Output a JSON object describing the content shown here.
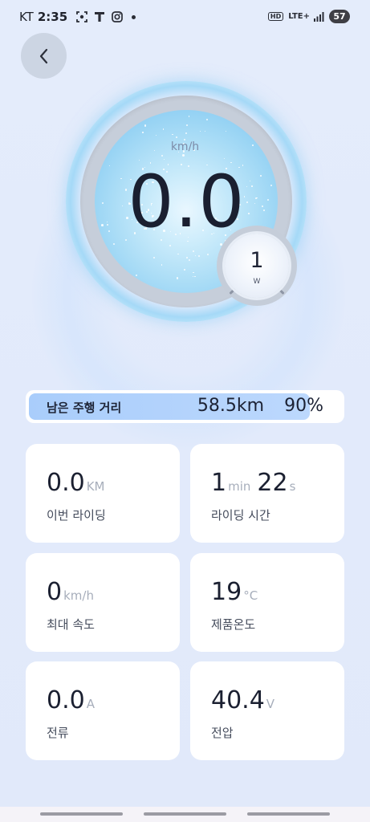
{
  "status_bar": {
    "carrier": "KT",
    "time": "2:35",
    "hd": "HD",
    "network": "LTE+",
    "battery": "57"
  },
  "gauge": {
    "speed_unit": "km/h",
    "speed_value": "0.0",
    "power_value": "1",
    "power_unit": "W"
  },
  "range": {
    "label": "남은 주행 거리",
    "distance": "58.5km",
    "percent": "90%",
    "fill_fraction": 0.9
  },
  "stats": [
    {
      "value": "0.0",
      "unit": "KM",
      "label": "이번 라이딩"
    },
    {
      "value": "1",
      "unit": "min",
      "value2": "22",
      "unit2": "s",
      "label": "라이딩 시간"
    },
    {
      "value": "0",
      "unit": "km/h",
      "label": "최대 속도"
    },
    {
      "value": "19",
      "unit": "°C",
      "label": "제품온도"
    },
    {
      "value": "0.0",
      "unit": "A",
      "label": "전류"
    },
    {
      "value": "40.4",
      "unit": "V",
      "label": "전압"
    }
  ],
  "colors": {
    "accent": "#a9cdfb",
    "gauge_glow": "#8fcff3",
    "text_primary": "#1b2031",
    "text_unit": "#a7aebb"
  }
}
